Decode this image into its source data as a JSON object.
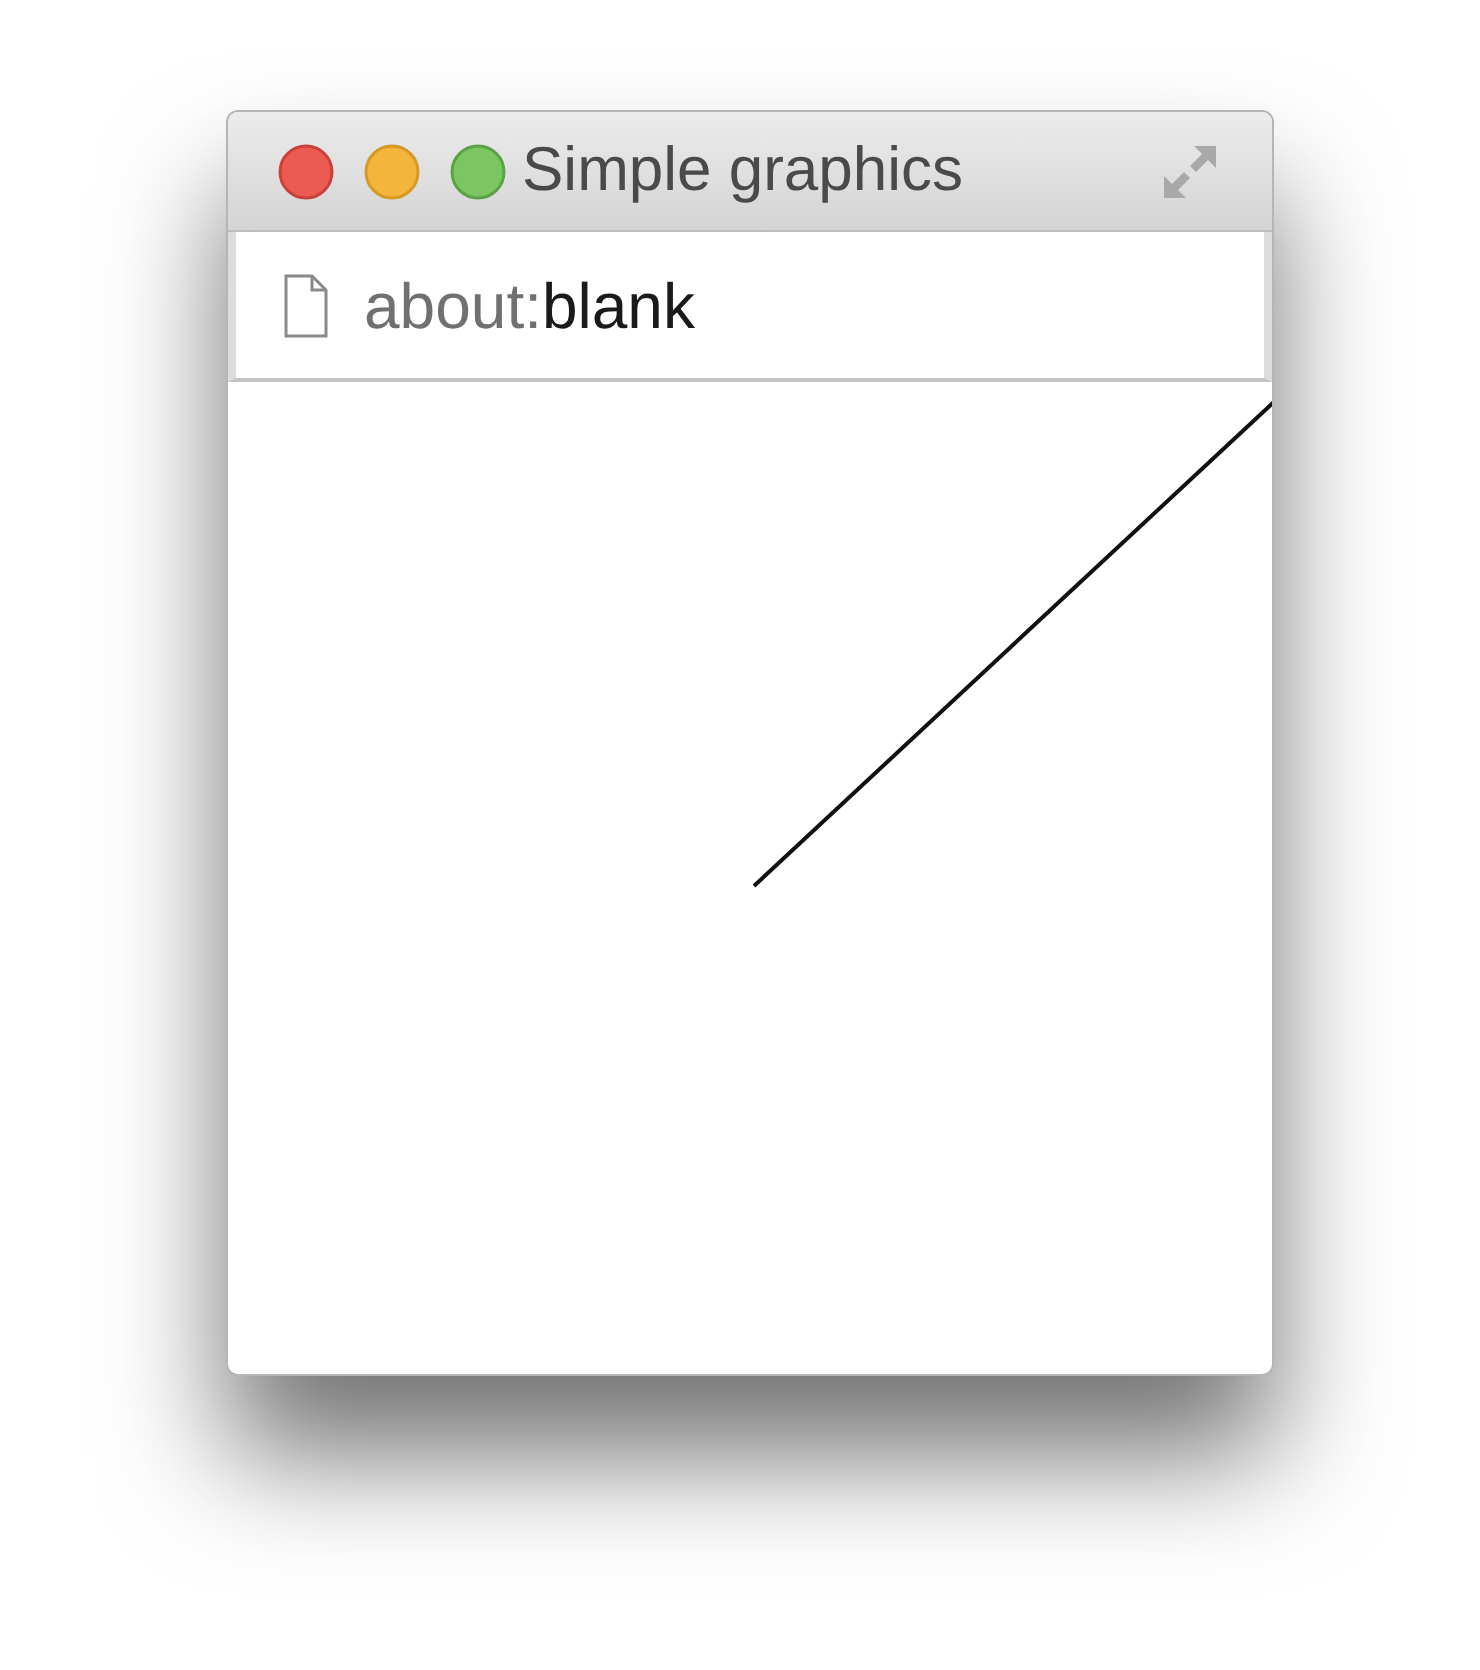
{
  "window": {
    "title": "Simple graphics"
  },
  "address_bar": {
    "scheme": "about:",
    "page": "blank"
  }
}
